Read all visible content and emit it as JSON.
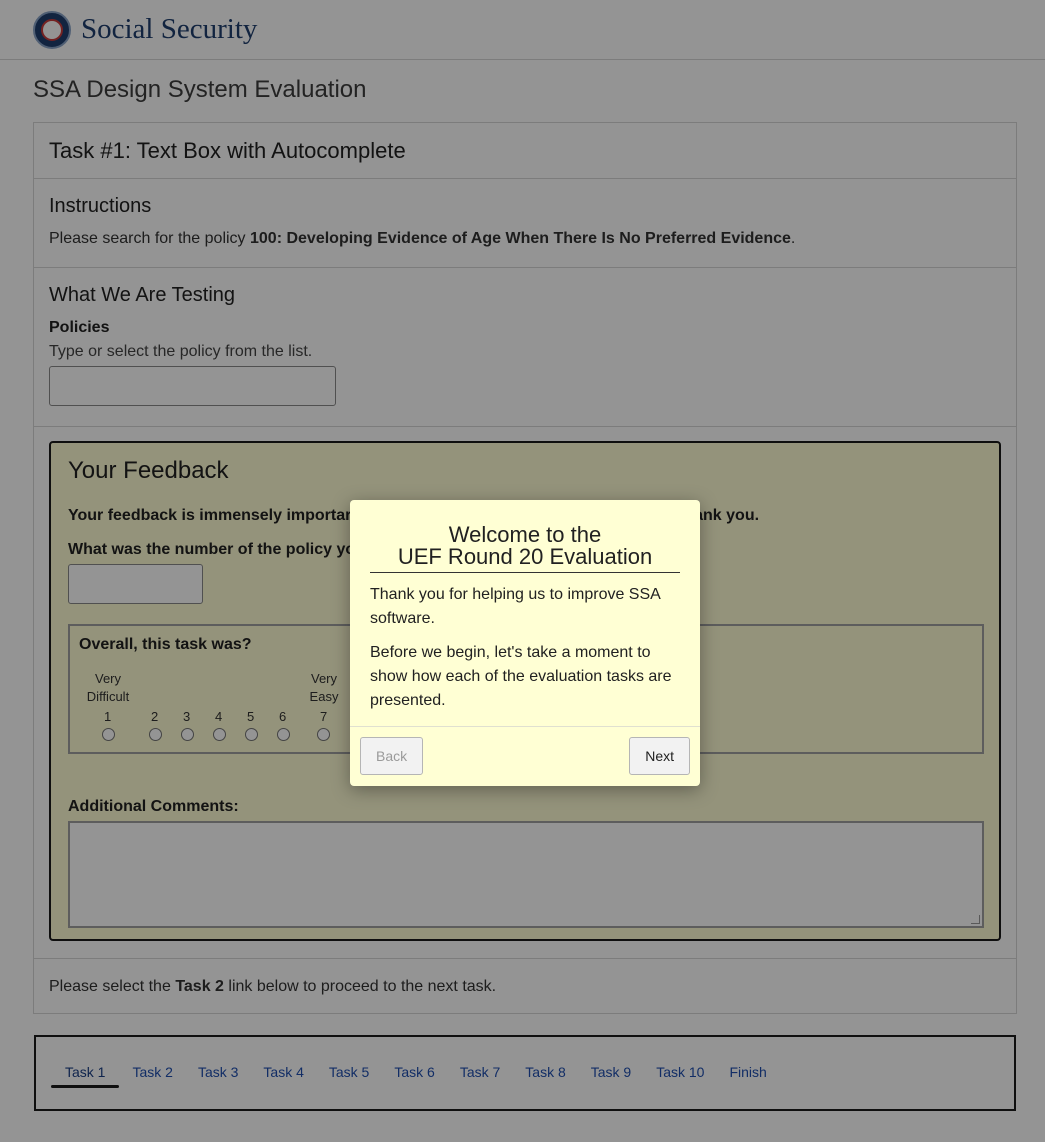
{
  "header": {
    "brand": "Social Security"
  },
  "page_title": "SSA Design System Evaluation",
  "task": {
    "title": "Task #1: Text Box with Autocomplete",
    "instructions_heading": "Instructions",
    "instructions_prefix": "Please search for the policy ",
    "instructions_policy": "100: Developing Evidence of Age When There Is No Preferred Evidence",
    "instructions_suffix": ".",
    "testing_heading": "What We Are Testing",
    "policies_label": "Policies",
    "policies_hint": "Type or select the policy from the list.",
    "policies_value": ""
  },
  "feedback": {
    "heading": "Your Feedback",
    "lead_left": "Your feedback is immensely importar",
    "lead_right": "hank you.",
    "number_question": "What was the number of the policy yo",
    "number_value": "",
    "rating_question": "Overall, this task was?",
    "rating_low_label": "Very Difficult",
    "rating_high_label": "Very Easy",
    "rating_options": [
      "1",
      "2",
      "3",
      "4",
      "5",
      "6",
      "7"
    ],
    "comments_label": "Additional Comments:",
    "comments_value": ""
  },
  "next_hint": {
    "prefix": "Please select the ",
    "link": "Task 2",
    "suffix": " link below to proceed to the next task."
  },
  "nav": {
    "items": [
      "Task 1",
      "Task 2",
      "Task 3",
      "Task 4",
      "Task 5",
      "Task 6",
      "Task 7",
      "Task 8",
      "Task 9",
      "Task 10",
      "Finish"
    ],
    "active": "Task 1"
  },
  "modal": {
    "title_line1": "Welcome to the",
    "title_line2": "UEF Round 20 Evaluation",
    "para1": "Thank you for helping us to improve SSA software.",
    "para2": "Before we begin, let's take a moment to show how each of the evaluation tasks are presented.",
    "back_label": "Back",
    "next_label": "Next"
  },
  "colors": {
    "brand": "#1f3f6e",
    "feedback_bg": "#fffdd4",
    "modal_bg": "#ffffd4",
    "link": "#1f4fb0"
  }
}
